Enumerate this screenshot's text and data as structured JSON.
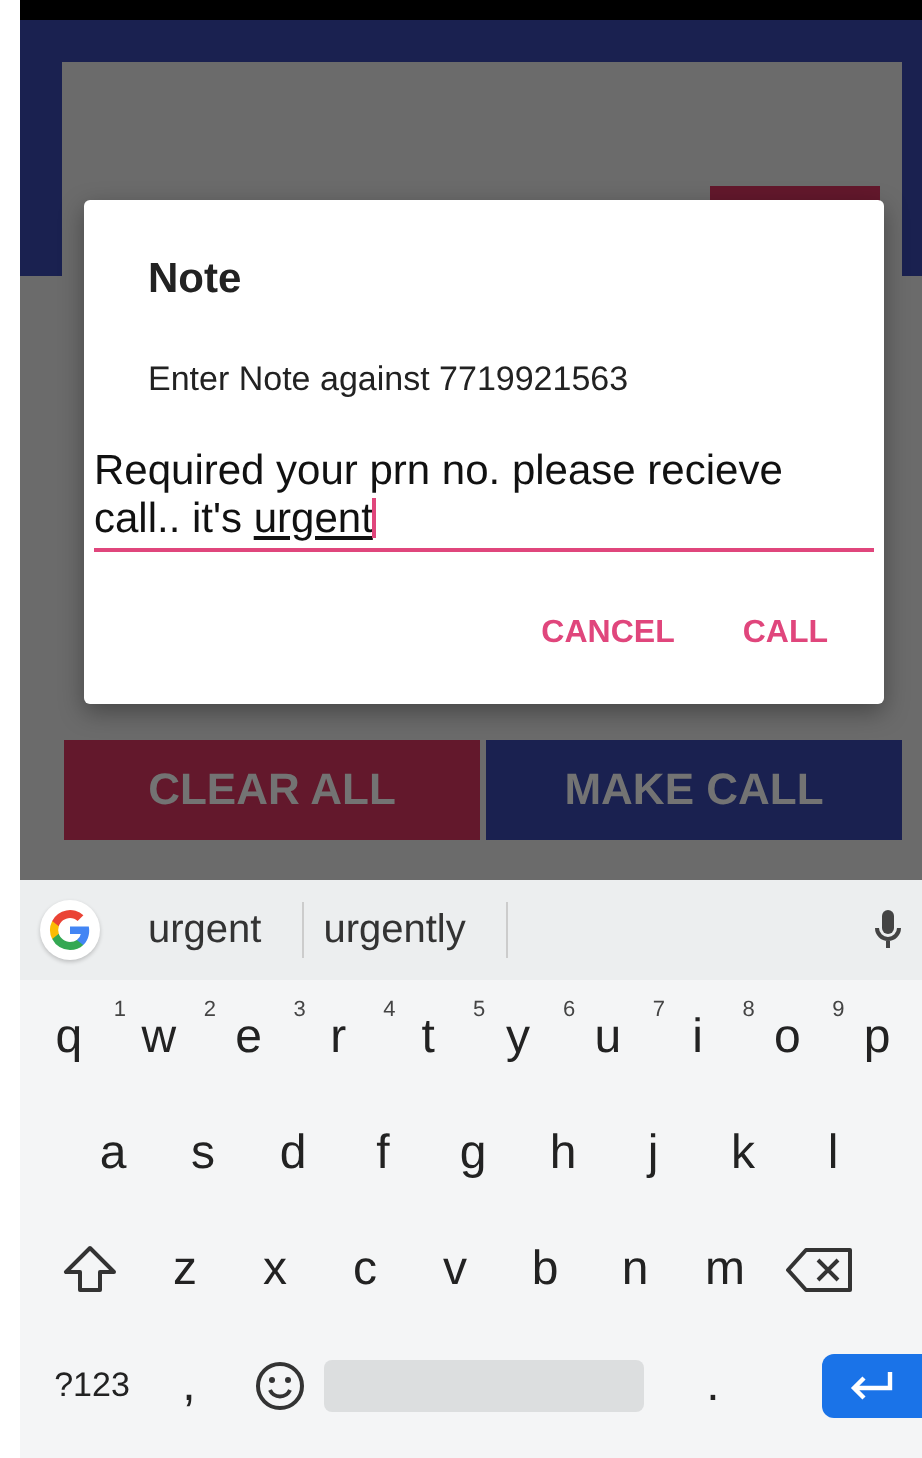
{
  "background_app": {
    "buttons": [
      {
        "label": "CLEAR ALL",
        "color": "#63182c"
      },
      {
        "label": "MAKE CALL",
        "color": "#1a2150"
      }
    ]
  },
  "dialog": {
    "title": "Note",
    "message": "Enter Note against 7719921563",
    "note": {
      "value": "Required your prn no. please recieve call.. it's ",
      "composing": "urgent"
    },
    "buttons": [
      "CANCEL",
      "CALL"
    ]
  },
  "keyboard": {
    "suggestions": [
      "urgent",
      "urgently"
    ],
    "rows": [
      [
        {
          "kind": "letter",
          "label": "q"
        },
        {
          "kind": "letter",
          "label": "w",
          "hint": "1"
        },
        {
          "kind": "letter",
          "label": "e",
          "hint": "2"
        },
        {
          "kind": "letter",
          "label": "r",
          "hint": "3"
        },
        {
          "kind": "letter",
          "label": "t",
          "hint": "4"
        },
        {
          "kind": "letter",
          "label": "y",
          "hint": "5"
        },
        {
          "kind": "letter",
          "label": "u",
          "hint": "6"
        },
        {
          "kind": "letter",
          "label": "i",
          "hint": "7"
        },
        {
          "kind": "letter",
          "label": "o",
          "hint": "8"
        },
        {
          "kind": "letter",
          "label": "p",
          "hint": "9"
        }
      ],
      [
        {
          "kind": "letter",
          "label": "a"
        },
        {
          "kind": "letter",
          "label": "s"
        },
        {
          "kind": "letter",
          "label": "d"
        },
        {
          "kind": "letter",
          "label": "f"
        },
        {
          "kind": "letter",
          "label": "g"
        },
        {
          "kind": "letter",
          "label": "h"
        },
        {
          "kind": "letter",
          "label": "j"
        },
        {
          "kind": "letter",
          "label": "k"
        },
        {
          "kind": "letter",
          "label": "l"
        }
      ],
      [
        {
          "kind": "shift"
        },
        {
          "kind": "letter",
          "label": "z"
        },
        {
          "kind": "letter",
          "label": "x"
        },
        {
          "kind": "letter",
          "label": "c"
        },
        {
          "kind": "letter",
          "label": "v"
        },
        {
          "kind": "letter",
          "label": "b"
        },
        {
          "kind": "letter",
          "label": "n"
        },
        {
          "kind": "letter",
          "label": "m"
        },
        {
          "kind": "backspace"
        }
      ],
      [
        {
          "kind": "symbols",
          "label": "?123"
        },
        {
          "kind": "letter",
          "label": ","
        },
        {
          "kind": "emoji"
        },
        {
          "kind": "space"
        },
        {
          "kind": "letter",
          "label": "."
        },
        {
          "kind": "enter"
        }
      ]
    ]
  }
}
